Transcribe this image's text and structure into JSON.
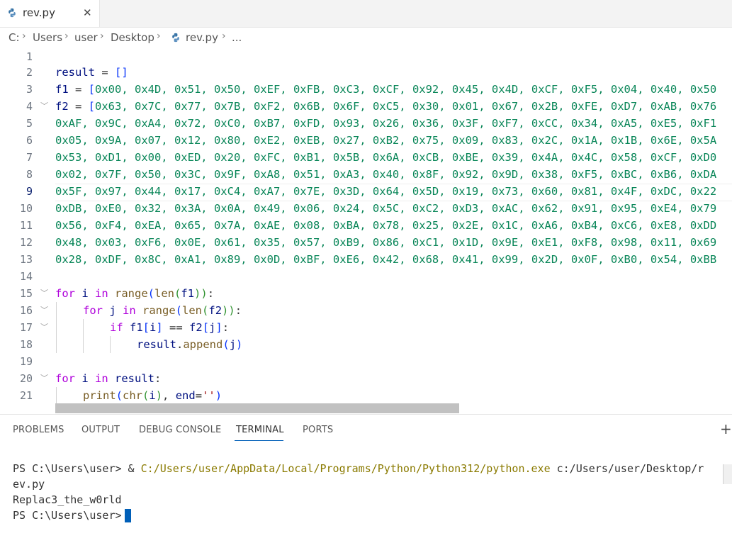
{
  "tab": {
    "label": "rev.py",
    "icon": "python-icon",
    "close": "✕"
  },
  "breadcrumb": [
    "C:",
    "Users",
    "user",
    "Desktop",
    "rev.py",
    "..."
  ],
  "editor": {
    "line_numbers": [
      "1",
      "2",
      "3",
      "4",
      "5",
      "6",
      "7",
      "8",
      "9",
      "10",
      "11",
      "12",
      "13",
      "14",
      "15",
      "16",
      "17",
      "18",
      "19",
      "20",
      "21"
    ],
    "current_line": "9",
    "code": {
      "l2_var": "result",
      "l2_eq": " = ",
      "l2_br": "[]",
      "l3_var": "f1",
      "l3_eq": " = ",
      "l3_br": "[",
      "l3_vals": "0x00, 0x4D, 0x51, 0x50, 0xEF, 0xFB, 0xC3, 0xCF, 0x92, 0x45, 0x4D, 0xCF, 0xF5, 0x04, 0x40, 0x50",
      "l4_var": "f2",
      "l4_eq": " = ",
      "l4_br": "[",
      "l4_vals": "0x63, 0x7C, 0x77, 0x7B, 0xF2, 0x6B, 0x6F, 0xC5, 0x30, 0x01, 0x67, 0x2B, 0xFE, 0xD7, 0xAB, 0x76",
      "l5": "0xAF, 0x9C, 0xA4, 0x72, 0xC0, 0xB7, 0xFD, 0x93, 0x26, 0x36, 0x3F, 0xF7, 0xCC, 0x34, 0xA5, 0xE5, 0xF1",
      "l6": "0x05, 0x9A, 0x07, 0x12, 0x80, 0xE2, 0xEB, 0x27, 0xB2, 0x75, 0x09, 0x83, 0x2C, 0x1A, 0x1B, 0x6E, 0x5A",
      "l7": "0x53, 0xD1, 0x00, 0xED, 0x20, 0xFC, 0xB1, 0x5B, 0x6A, 0xCB, 0xBE, 0x39, 0x4A, 0x4C, 0x58, 0xCF, 0xD0",
      "l8": "0x02, 0x7F, 0x50, 0x3C, 0x9F, 0xA8, 0x51, 0xA3, 0x40, 0x8F, 0x92, 0x9D, 0x38, 0xF5, 0xBC, 0xB6, 0xDA",
      "l9": "0x5F, 0x97, 0x44, 0x17, 0xC4, 0xA7, 0x7E, 0x3D, 0x64, 0x5D, 0x19, 0x73, 0x60, 0x81, 0x4F, 0xDC, 0x22",
      "l10": "0xDB, 0xE0, 0x32, 0x3A, 0x0A, 0x49, 0x06, 0x24, 0x5C, 0xC2, 0xD3, 0xAC, 0x62, 0x91, 0x95, 0xE4, 0x79",
      "l11": "0x56, 0xF4, 0xEA, 0x65, 0x7A, 0xAE, 0x08, 0xBA, 0x78, 0x25, 0x2E, 0x1C, 0xA6, 0xB4, 0xC6, 0xE8, 0xDD",
      "l12": "0x48, 0x03, 0xF6, 0x0E, 0x61, 0x35, 0x57, 0xB9, 0x86, 0xC1, 0x1D, 0x9E, 0xE1, 0xF8, 0x98, 0x11, 0x69",
      "l13": "0x28, 0xDF, 0x8C, 0xA1, 0x89, 0x0D, 0xBF, 0xE6, 0x42, 0x68, 0x41, 0x99, 0x2D, 0x0F, 0xB0, 0x54, 0xBB",
      "l15_for": "for",
      "l15_i": " i ",
      "l15_in": "in",
      "l15_range": " range",
      "l15_p1": "(",
      "l15_len": "len",
      "l15_p2": "(",
      "l15_f1": "f1",
      "l15_p3": "))",
      "l15_colon": ":",
      "l16_for": "for",
      "l16_j": " j ",
      "l16_in": "in",
      "l16_range": " range",
      "l16_p1": "(",
      "l16_len": "len",
      "l16_p2": "(",
      "l16_f2": "f2",
      "l16_p3": "))",
      "l16_colon": ":",
      "l17_if": "if",
      "l17_f1": " f1",
      "l17_b1": "[",
      "l17_i": "i",
      "l17_b2": "]",
      "l17_eq": " == ",
      "l17_f2": "f2",
      "l17_b3": "[",
      "l17_j": "j",
      "l17_b4": "]",
      "l17_colon": ":",
      "l18_result": "result",
      "l18_dot": ".",
      "l18_append": "append",
      "l18_p1": "(",
      "l18_j": "j",
      "l18_p2": ")",
      "l20_for": "for",
      "l20_i": " i ",
      "l20_in": "in",
      "l20_result": " result",
      "l20_colon": ":",
      "l21_print": "print",
      "l21_p1": "(",
      "l21_chr": "chr",
      "l21_p2": "(",
      "l21_i": "i",
      "l21_p3": ")",
      "l21_comma": ", ",
      "l21_end": "end",
      "l21_eq": "=",
      "l21_str": "''",
      "l21_p4": ")"
    }
  },
  "panel": {
    "tabs": [
      "PROBLEMS",
      "OUTPUT",
      "DEBUG CONSOLE",
      "TERMINAL",
      "PORTS"
    ],
    "active_tab": "TERMINAL",
    "plus": "+",
    "terminal": {
      "prompt1": "PS C:\\Users\\user> & ",
      "exe_path": "C:/Users/user/AppData/Local/Programs/Python/Python312/python.exe",
      "arg_part1": " c:/Users/user/Desktop/r",
      "arg_part2": "ev.py",
      "output": "Replac3_the_w0rld",
      "prompt2": "PS C:\\Users\\user>"
    }
  },
  "colors": {
    "accent": "#005fb8",
    "keyword": "#af00db",
    "number": "#098658",
    "function": "#795e26",
    "variable": "#001080"
  }
}
